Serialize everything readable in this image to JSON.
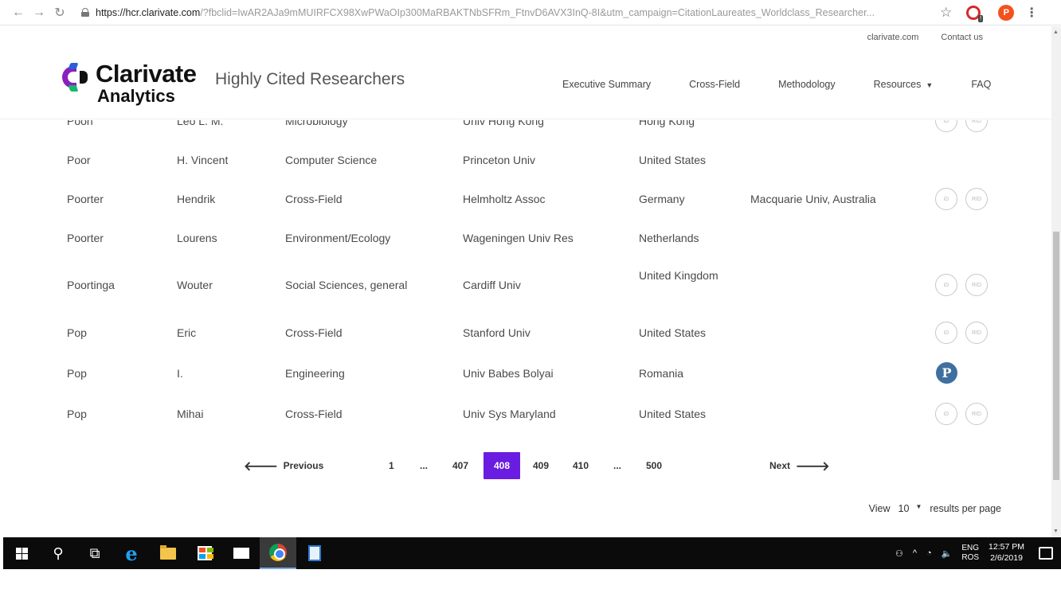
{
  "browser": {
    "url_host": "https://hcr.clarivate.com",
    "url_rest": "/?fbclid=IwAR2AJa9mMUIRFCX98XwPWaOIp300MaRBAKTNbSFRm_FtnvD6AVX3InQ-8I&utm_campaign=CitationLaureates_Worldclass_Researcher...",
    "profile_initial": "P"
  },
  "header": {
    "top_links": [
      "clarivate.com",
      "Contact us"
    ],
    "logo_brand": "Clarivate",
    "logo_sub": "Analytics",
    "site_title": "Highly Cited Researchers",
    "nav": [
      "Executive Summary",
      "Cross-Field",
      "Methodology",
      "Resources",
      "FAQ"
    ]
  },
  "table": {
    "rows": [
      {
        "last": "Poon",
        "first": "Leo L. M.",
        "field": "Microbiology",
        "institution": "Univ Hong Kong",
        "country": "Hong Kong",
        "secondary": "",
        "badges": "orcid-rid"
      },
      {
        "last": "Poor",
        "first": "H. Vincent",
        "field": "Computer Science",
        "institution": "Princeton Univ",
        "country": "United States",
        "secondary": "",
        "badges": "none"
      },
      {
        "last": "Poorter",
        "first": "Hendrik",
        "field": "Cross-Field",
        "institution": "Helmholtz Assoc",
        "country": "Germany",
        "secondary": "Macquarie Univ, Australia",
        "badges": "orcid-rid"
      },
      {
        "last": "Poorter",
        "first": "Lourens",
        "field": "Environment/Ecology",
        "institution": "Wageningen Univ Res",
        "country": "Netherlands",
        "secondary": "",
        "badges": "none"
      },
      {
        "last": "Poortinga",
        "first": "Wouter",
        "field": "Social Sciences, general",
        "institution": "Cardiff Univ",
        "country": "United Kingdom",
        "secondary": "",
        "badges": "orcid-rid"
      },
      {
        "last": "Pop",
        "first": "Eric",
        "field": "Cross-Field",
        "institution": "Stanford Univ",
        "country": "United States",
        "secondary": "",
        "badges": "orcid-rid"
      },
      {
        "last": "Pop",
        "first": "I.",
        "field": "Engineering",
        "institution": "Univ Babes Bolyai",
        "country": "Romania",
        "secondary": "",
        "badges": "publons"
      },
      {
        "last": "Pop",
        "first": "Mihai",
        "field": "Cross-Field",
        "institution": "Univ Sys Maryland",
        "country": "United States",
        "secondary": "",
        "badges": "orcid-rid"
      }
    ],
    "badge_labels": {
      "orcid": "iD",
      "rid": "RID",
      "publons": "P"
    }
  },
  "pagination": {
    "previous": "Previous",
    "next": "Next",
    "pages": [
      "1",
      "...",
      "407",
      "408",
      "409",
      "410",
      "...",
      "500"
    ],
    "current": "408"
  },
  "results": {
    "view_label": "View",
    "per_page_value": "10",
    "suffix": "results per page"
  },
  "taskbar": {
    "lang_top": "ENG",
    "lang_bottom": "ROS",
    "time": "12:57 PM",
    "date": "2/6/2019"
  },
  "colors": {
    "accent": "#6a1de0",
    "publons": "#3f6fa0"
  }
}
